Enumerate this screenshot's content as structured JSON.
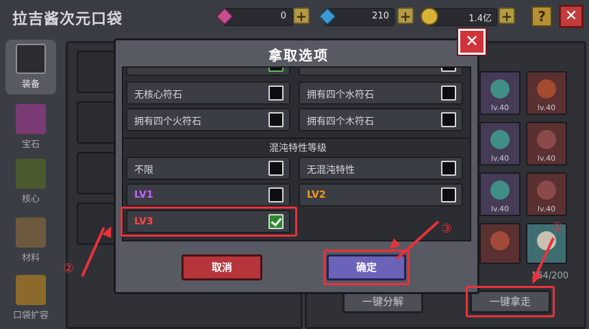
{
  "header": {
    "title": "拉吉酱次元口袋",
    "currency": [
      {
        "icon": "purple-gem-icon",
        "value": "0"
      },
      {
        "icon": "blue-diamond-icon",
        "value": "210"
      },
      {
        "icon": "gold-coin-icon",
        "value": "1.4亿"
      }
    ],
    "plus_label": "+",
    "help_label": "?",
    "close_label": "✕"
  },
  "sidebar": {
    "items": [
      {
        "label": "装备",
        "active": true
      },
      {
        "label": "宝石"
      },
      {
        "label": "核心"
      },
      {
        "label": "材料"
      },
      {
        "label": "口袋扩容"
      }
    ]
  },
  "inventory": {
    "level_label": "lv.40",
    "capacity": "164/200",
    "decompose_button": "一键分解",
    "take_all_button": "一键拿走"
  },
  "modal": {
    "title": "拿取选项",
    "close_label": "✕",
    "options_top": [
      {
        "label": "无核心符石",
        "checked": false
      },
      {
        "label": "拥有四个水符石",
        "checked": false
      },
      {
        "label": "拥有四个火符石",
        "checked": false
      },
      {
        "label": "拥有四个木符石",
        "checked": false
      }
    ],
    "section_title": "混沌特性等级",
    "options_chaos": [
      {
        "label": "不限",
        "checked": false
      },
      {
        "label": "无混沌特性",
        "checked": false
      },
      {
        "label": "LV1",
        "checked": false
      },
      {
        "label": "LV2",
        "checked": false
      },
      {
        "label": "LV3",
        "checked": true
      }
    ],
    "cancel_label": "取消",
    "confirm_label": "确定"
  },
  "annotations": {
    "step1": "①",
    "step2": "②",
    "step3": "③",
    "color": "#e8323a"
  }
}
